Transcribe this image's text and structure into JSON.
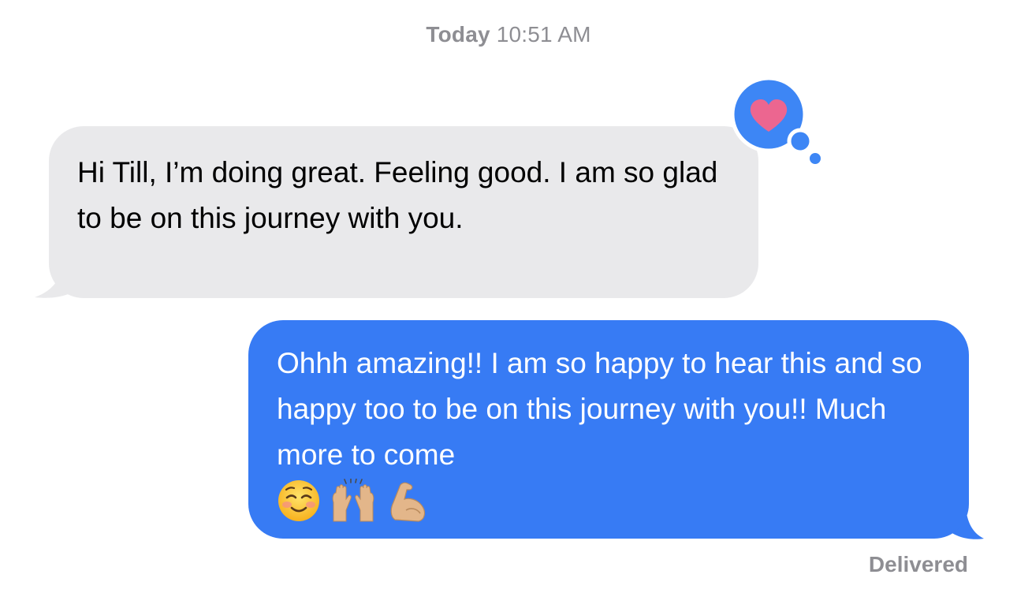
{
  "conversation": {
    "timestamp": {
      "day": "Today",
      "time": "10:51 AM"
    },
    "messages": [
      {
        "direction": "received",
        "text": "Hi Till, I’m doing great. Feeling good. I am so glad to be on this journey with you.",
        "reaction": "heart-icon"
      },
      {
        "direction": "sent",
        "text": "Ohhh amazing!! I am so happy to hear this and so happy too to be on this journey with you!! Much more to come",
        "emojis": [
          "smiling-face-icon",
          "raising-hands-icon",
          "flexed-biceps-icon"
        ]
      }
    ],
    "status": "Delivered"
  },
  "colors": {
    "received_bubble": "#e9e9eb",
    "sent_bubble": "#377bf4",
    "tapback": "#3d86f5",
    "heart": "#ec6690",
    "meta_text": "#8e8e93"
  }
}
